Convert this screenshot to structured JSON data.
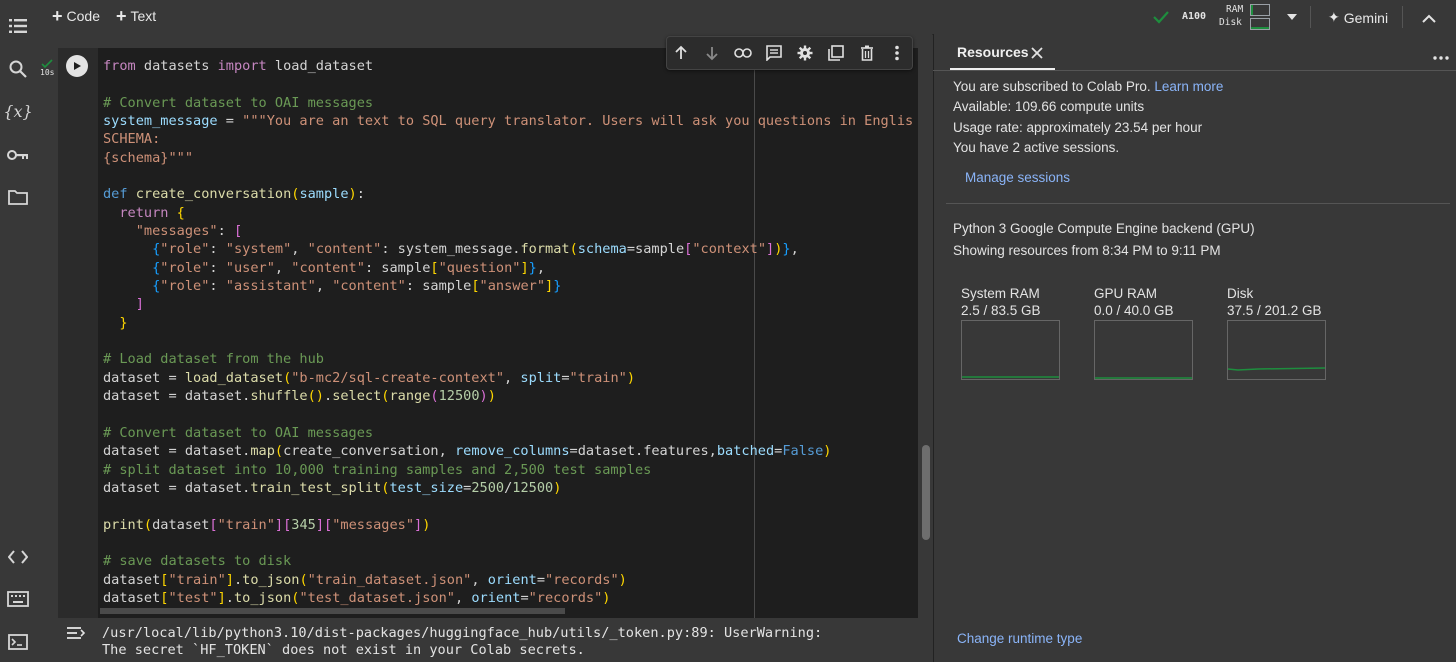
{
  "toolbar": {
    "code_label": "Code",
    "text_label": "Text",
    "gpu_label": "A100",
    "ram_label": "RAM",
    "disk_label": "Disk",
    "gemini_label": "Gemini"
  },
  "cell": {
    "exec_time": "10s"
  },
  "code_lines": [
    "from datasets import load_dataset",
    "",
    "# Convert dataset to OAI messages",
    "system_message = \"\"\"You are an text to SQL query translator. Users will ask you questions in Englis",
    "SCHEMA:",
    "{schema}\"\"\"",
    "",
    "def create_conversation(sample):",
    "  return {",
    "    \"messages\": [",
    "      {\"role\": \"system\", \"content\": system_message.format(schema=sample[\"context\"])},",
    "      {\"role\": \"user\", \"content\": sample[\"question\"]},",
    "      {\"role\": \"assistant\", \"content\": sample[\"answer\"]}",
    "    ]",
    "  }",
    "",
    "# Load dataset from the hub",
    "dataset = load_dataset(\"b-mc2/sql-create-context\", split=\"train\")",
    "dataset = dataset.shuffle().select(range(12500))",
    "",
    "# Convert dataset to OAI messages",
    "dataset = dataset.map(create_conversation, remove_columns=dataset.features,batched=False)",
    "# split dataset into 10,000 training samples and 2,500 test samples",
    "dataset = dataset.train_test_split(test_size=2500/12500)",
    "",
    "print(dataset[\"train\"][345][\"messages\"])",
    "",
    "# save datasets to disk",
    "dataset[\"train\"].to_json(\"train_dataset.json\", orient=\"records\")",
    "dataset[\"test\"].to_json(\"test_dataset.json\", orient=\"records\")"
  ],
  "output": {
    "line1": "/usr/local/lib/python3.10/dist-packages/huggingface_hub/utils/_token.py:89: UserWarning:",
    "line2": "The secret `HF_TOKEN` does not exist in your Colab secrets."
  },
  "panel": {
    "tab_label": "Resources",
    "subscribed_text": "You are subscribed to Colab Pro.",
    "learn_more": "Learn more",
    "available": "Available: 109.66 compute units",
    "usage_rate": "Usage rate: approximately 23.54 per hour",
    "sessions": "You have 2 active sessions.",
    "manage_sessions": "Manage sessions",
    "backend": "Python 3 Google Compute Engine backend (GPU)",
    "showing": "Showing resources from 8:34 PM to 9:11 PM",
    "change_runtime": "Change runtime type",
    "resources": [
      {
        "label": "System RAM",
        "value": "2.5 / 83.5 GB",
        "used": 2.5,
        "total": 83.5
      },
      {
        "label": "GPU RAM",
        "value": "0.0 / 40.0 GB",
        "used": 0.0,
        "total": 40.0
      },
      {
        "label": "Disk",
        "value": "37.5 / 201.2 GB",
        "used": 37.5,
        "total": 201.2
      }
    ]
  },
  "colors": {
    "accent_green": "#1e8e3e",
    "link_blue": "#8ab4f8"
  }
}
